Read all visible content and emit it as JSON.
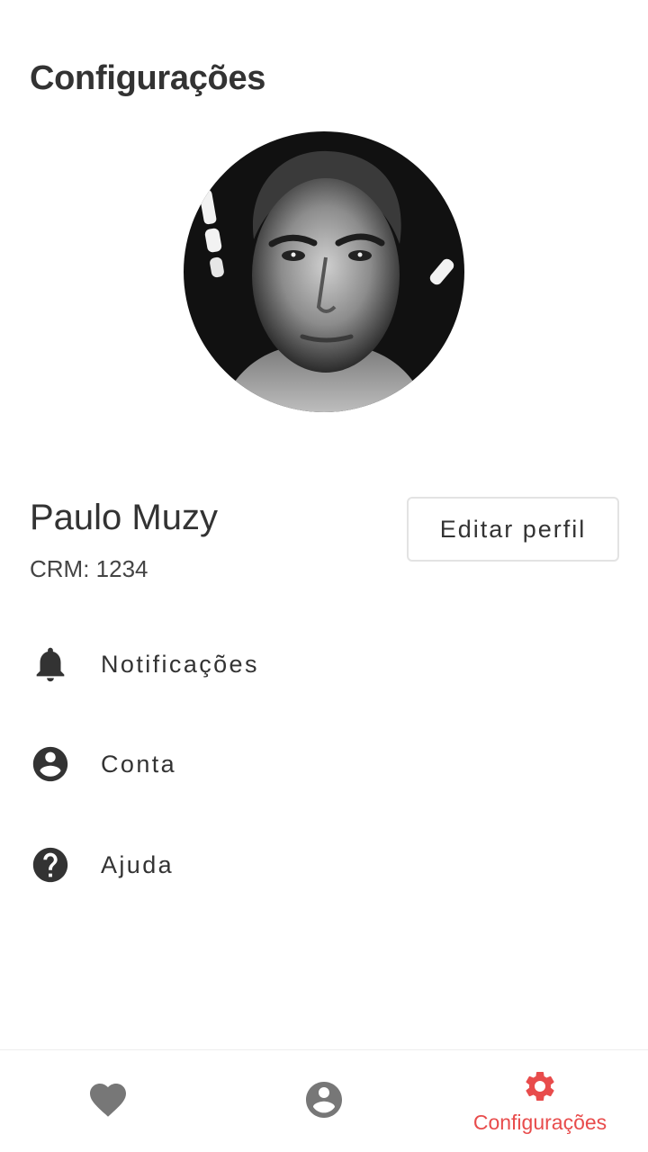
{
  "header": {
    "title": "Configurações"
  },
  "profile": {
    "name": "Paulo Muzy",
    "crm": "CRM: 1234",
    "edit_label": "Editar perfil"
  },
  "menu": {
    "items": [
      {
        "label": "Notificações",
        "icon": "bell-icon"
      },
      {
        "label": "Conta",
        "icon": "account-circle-icon"
      },
      {
        "label": "Ajuda",
        "icon": "help-circle-icon"
      }
    ]
  },
  "bottom_nav": {
    "items": [
      {
        "icon": "heart-icon",
        "label": ""
      },
      {
        "icon": "account-circle-icon",
        "label": ""
      },
      {
        "icon": "gear-icon",
        "label": "Configurações",
        "active": true
      }
    ]
  },
  "colors": {
    "accent": "#e84c4c",
    "text": "#333333",
    "inactive_icon": "#777777"
  }
}
